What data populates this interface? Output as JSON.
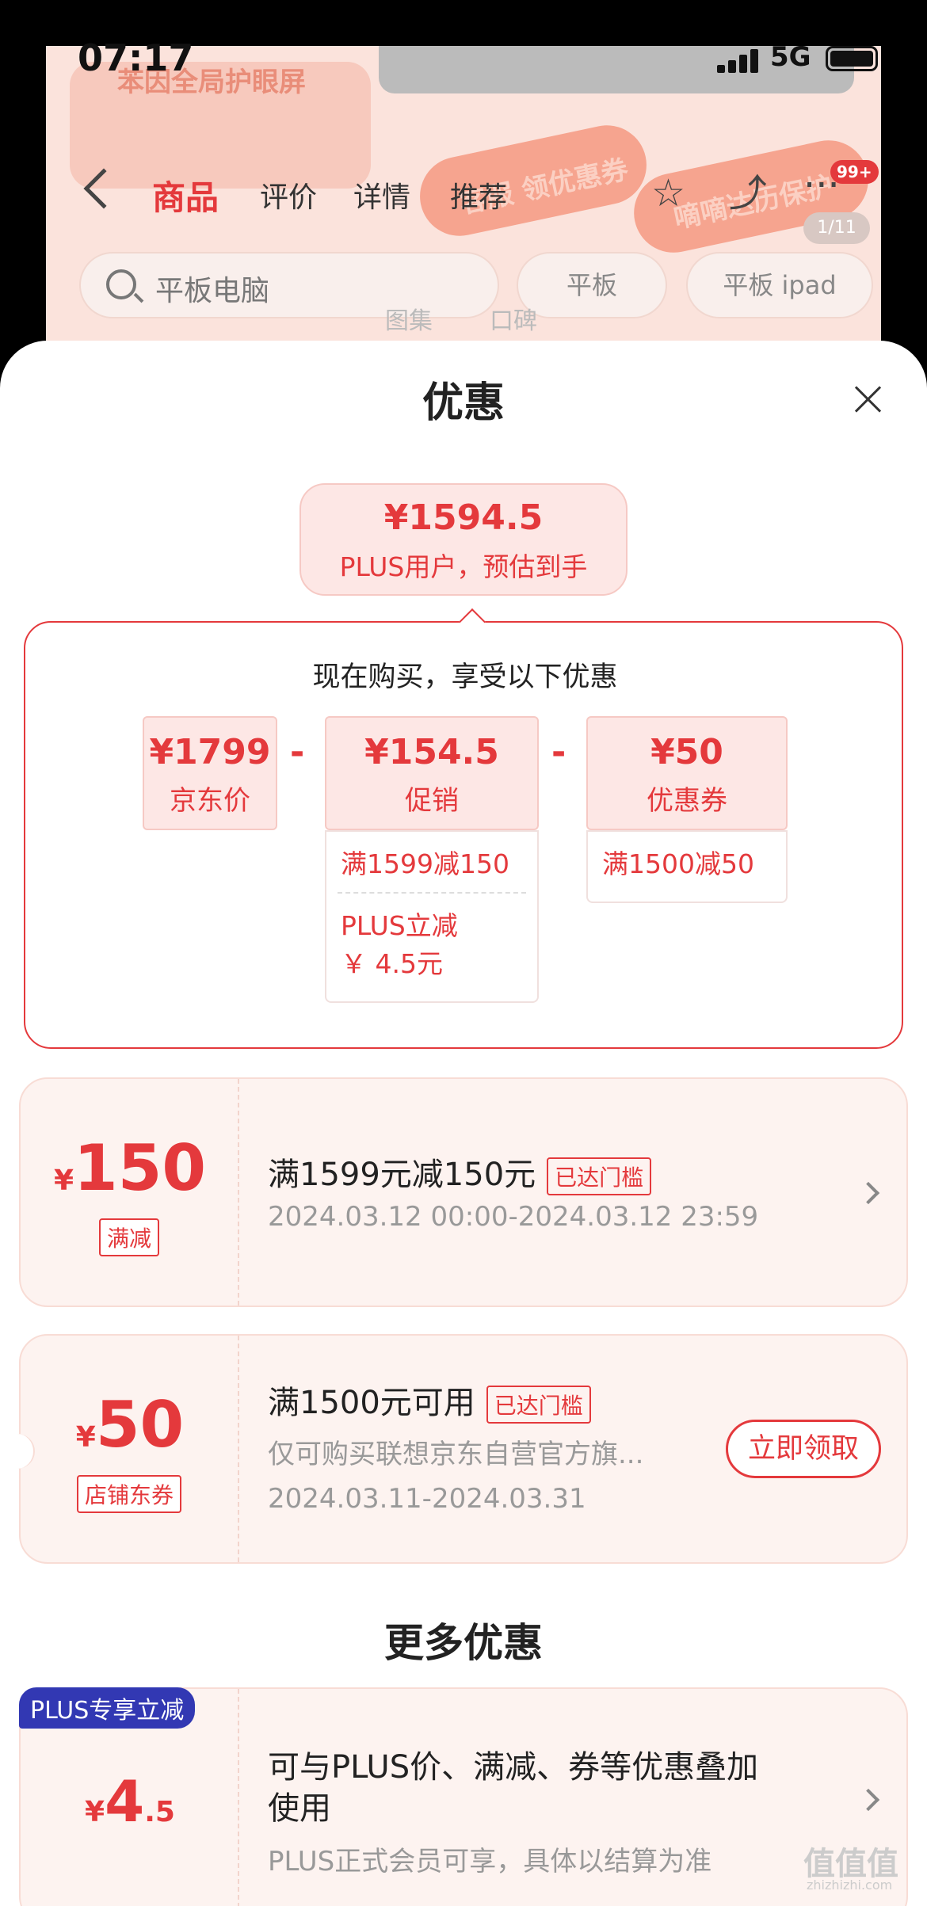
{
  "status": {
    "time": "07:17",
    "network": "5G"
  },
  "background": {
    "banner_text": "苯因全局护眼屏",
    "promo1": "客服 领优惠券",
    "promo2": "嘀嘀达历保护",
    "pager": "1/11",
    "nav_tabs": [
      "商品",
      "评价",
      "详情",
      "推荐"
    ],
    "cart_badge": "99+",
    "search_placeholder": "平板电脑",
    "chips": [
      "平板",
      "平板 ipad"
    ],
    "subtabs": [
      "图集",
      "口碑"
    ]
  },
  "sheet": {
    "title": "优惠",
    "estimate": {
      "price": "¥1594.5",
      "label": "PLUS用户，预估到手"
    },
    "calc": {
      "heading": "现在购买，享受以下优惠",
      "jd_price": {
        "value": "¥1799",
        "label": "京东价"
      },
      "promo": {
        "value": "¥154.5",
        "label": "促销",
        "details": [
          "满1599减150",
          "PLUS立减",
          "￥ 4.5元"
        ]
      },
      "coupon": {
        "value": "¥50",
        "label": "优惠券",
        "details": [
          "满1500减50"
        ]
      },
      "minus": "-"
    },
    "coupons": [
      {
        "yen": "¥",
        "amount": "150",
        "tag": "满减",
        "title": "满1599元减150元",
        "badge": "已达门槛",
        "sub": "2024.03.12 00:00-2024.03.12 23:59"
      },
      {
        "yen": "¥",
        "amount": "50",
        "tag": "店铺东券",
        "title": "满1500元可用",
        "badge": "已达门槛",
        "sub": "仅可购买联想京东自营官方旗...",
        "sub2": "2024.03.11-2024.03.31",
        "button": "立即领取"
      }
    ],
    "more_title": "更多优惠",
    "plus": {
      "tag": "PLUS专享立减",
      "yen": "¥",
      "amount": "4",
      "decimal": ".5",
      "title_line1": "可与PLUS价、满减、券等优惠叠加",
      "title_line2": "使用",
      "sub": "PLUS正式会员可享，具体以结算为准"
    }
  },
  "watermark": {
    "main": "值值值",
    "sub": "zhizhizhi.com"
  }
}
